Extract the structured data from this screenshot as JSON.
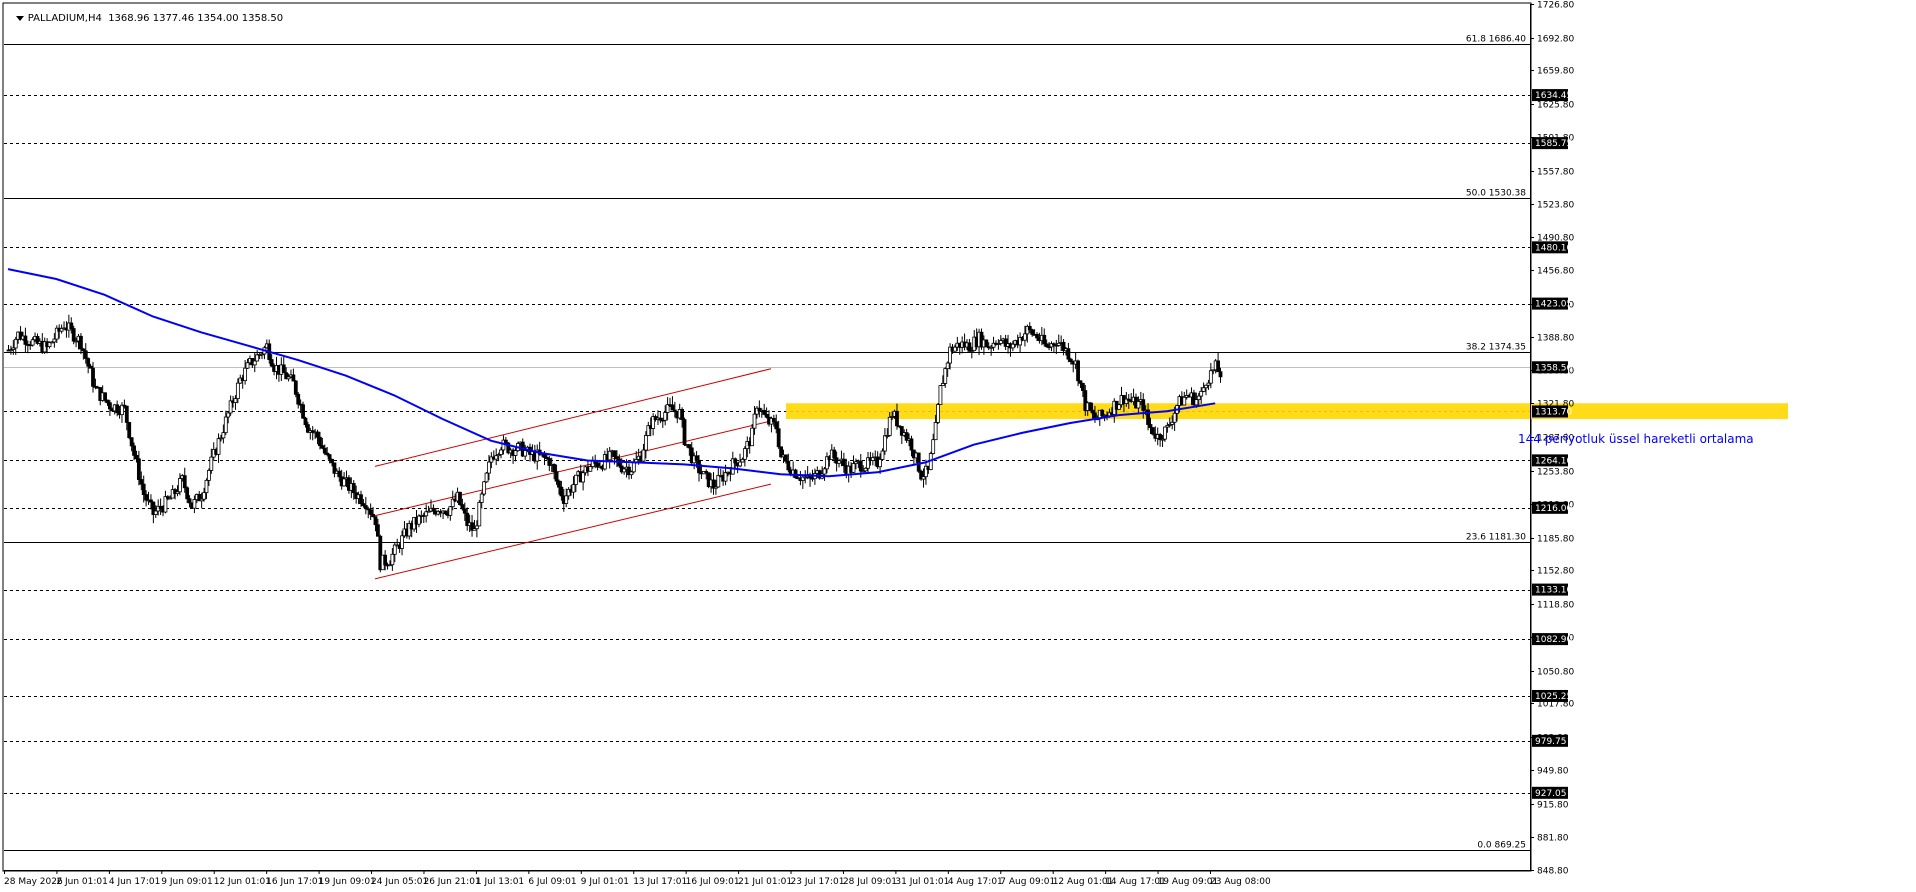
{
  "header": {
    "symbol_tf": "PALLADIUM,H4",
    "ohlc": "1368.96 1377.46 1354.00 1358.50"
  },
  "colors": {
    "background": "#ffffff",
    "grid": "#000000",
    "candle_bull": "#ffffff",
    "candle_bear": "#000000",
    "ema": "#0000ff",
    "channel": "#cc0000",
    "zone": "#ffd700",
    "annotation_text": "#0000ff",
    "price_tag_bg": "#000000",
    "price_tag_text": "#ffffff"
  },
  "annotation": "144 periyotluk üssel hareketli ortalama",
  "chart_data": {
    "type": "candlestick",
    "title": "PALLADIUM,H4",
    "ylim": [
      848.8,
      1726.8
    ],
    "y_ticks": [
      "1726.80",
      "1692.80",
      "1659.80",
      "1625.80",
      "1591.80",
      "1557.80",
      "1523.80",
      "1490.80",
      "1456.80",
      "1422.80",
      "1388.80",
      "1355.80",
      "1321.80",
      "1287.80",
      "1253.80",
      "1219.80",
      "1185.80",
      "1152.80",
      "1118.80",
      "1084.80",
      "1050.80",
      "1017.80",
      "983.80",
      "949.80",
      "915.80",
      "881.80",
      "848.80"
    ],
    "x_tick_labels": [
      "28 May 2026",
      "2 Jun 01:01",
      "4 Jun 17:01",
      "9 Jun 09:01",
      "12 Jun 01:01",
      "16 Jun 17:01",
      "19 Jun 09:01",
      "24 Jun 05:01",
      "26 Jun 21:01",
      "1 Jul 13:01",
      "6 Jul 09:01",
      "9 Jul 01:01",
      "13 Jul 17:01",
      "16 Jul 09:01",
      "21 Jul 01:01",
      "23 Jul 17:01",
      "28 Jul 09:01",
      "31 Jul 01:01",
      "4 Aug 17:01",
      "7 Aug 09:01",
      "12 Aug 01:01",
      "14 Aug 17:01",
      "19 Aug 09:01",
      "23 Aug 08:00"
    ],
    "horizontal_levels": [
      {
        "price": 1634.45,
        "label": "1634.45",
        "style": "dashed",
        "tag": true
      },
      {
        "price": 1585.75,
        "label": "1585.75",
        "style": "dashed",
        "tag": true
      },
      {
        "price": 1480.1,
        "label": "1480.10",
        "style": "dashed",
        "tag": true
      },
      {
        "price": 1423.05,
        "label": "1423.05",
        "style": "dashed",
        "tag": true
      },
      {
        "price": 1313.7,
        "label": "1313.70",
        "style": "dashed",
        "tag": true
      },
      {
        "price": 1264.1,
        "label": "1264.10",
        "style": "dashed",
        "tag": true
      },
      {
        "price": 1216.0,
        "label": "1216.00",
        "style": "dashed",
        "tag": true
      },
      {
        "price": 1133.1,
        "label": "1133.10",
        "style": "dashed",
        "tag": true
      },
      {
        "price": 1082.9,
        "label": "1082.90",
        "style": "dashed",
        "tag": true
      },
      {
        "price": 1025.25,
        "label": "1025.25",
        "style": "dashed",
        "tag": true
      },
      {
        "price": 979.75,
        "label": "979.75",
        "style": "dashed",
        "tag": true
      },
      {
        "price": 927.05,
        "label": "927.05",
        "style": "dashed",
        "tag": true
      }
    ],
    "fibo_levels": [
      {
        "price": 1686.4,
        "label": "61.8 1686.40"
      },
      {
        "price": 1530.38,
        "label": "50.0 1530.38"
      },
      {
        "price": 1374.35,
        "label": "38.2 1374.35"
      },
      {
        "price": 1181.3,
        "label": "23.6 1181.30"
      },
      {
        "price": 869.25,
        "label": "0.0 869.25"
      }
    ],
    "current_price": {
      "price": 1358.5,
      "label": "1358.50"
    },
    "zone": {
      "from_bar": 256,
      "to_bar": 585,
      "low": 1306,
      "high": 1322
    },
    "channel_lines": [
      {
        "bar1": 152,
        "price1": 1258,
        "bar2": 316,
        "price2": 1357
      },
      {
        "bar1": 152,
        "price1": 1208,
        "bar2": 316,
        "price2": 1304
      },
      {
        "bar1": 152,
        "price1": 1144,
        "bar2": 316,
        "price2": 1240
      }
    ],
    "close_path": [
      [
        0,
        1376
      ],
      [
        4,
        1392
      ],
      [
        10,
        1384
      ],
      [
        16,
        1378
      ],
      [
        23,
        1402
      ],
      [
        30,
        1384
      ],
      [
        36,
        1336
      ],
      [
        42,
        1320
      ],
      [
        48,
        1316
      ],
      [
        52,
        1270
      ],
      [
        56,
        1230
      ],
      [
        60,
        1210
      ],
      [
        64,
        1218
      ],
      [
        68,
        1228
      ],
      [
        72,
        1244
      ],
      [
        76,
        1218
      ],
      [
        80,
        1230
      ],
      [
        84,
        1262
      ],
      [
        88,
        1290
      ],
      [
        92,
        1318
      ],
      [
        96,
        1346
      ],
      [
        100,
        1362
      ],
      [
        104,
        1372
      ],
      [
        107,
        1380
      ],
      [
        110,
        1360
      ],
      [
        114,
        1352
      ],
      [
        118,
        1342
      ],
      [
        121,
        1320
      ],
      [
        124,
        1298
      ],
      [
        128,
        1288
      ],
      [
        132,
        1266
      ],
      [
        136,
        1250
      ],
      [
        140,
        1240
      ],
      [
        144,
        1230
      ],
      [
        148,
        1222
      ],
      [
        152,
        1204
      ],
      [
        154,
        1160
      ],
      [
        158,
        1164
      ],
      [
        162,
        1180
      ],
      [
        166,
        1196
      ],
      [
        170,
        1204
      ],
      [
        174,
        1210
      ],
      [
        178,
        1216
      ],
      [
        182,
        1214
      ],
      [
        186,
        1226
      ],
      [
        190,
        1200
      ],
      [
        193,
        1192
      ],
      [
        196,
        1226
      ],
      [
        200,
        1268
      ],
      [
        204,
        1280
      ],
      [
        208,
        1276
      ],
      [
        212,
        1276
      ],
      [
        216,
        1270
      ],
      [
        220,
        1268
      ],
      [
        224,
        1264
      ],
      [
        228,
        1236
      ],
      [
        230,
        1226
      ],
      [
        234,
        1240
      ],
      [
        238,
        1252
      ],
      [
        242,
        1260
      ],
      [
        246,
        1262
      ],
      [
        250,
        1268
      ],
      [
        254,
        1258
      ],
      [
        258,
        1256
      ],
      [
        262,
        1270
      ],
      [
        266,
        1302
      ],
      [
        270,
        1310
      ],
      [
        274,
        1316
      ],
      [
        278,
        1312
      ],
      [
        280,
        1286
      ],
      [
        284,
        1262
      ],
      [
        288,
        1248
      ],
      [
        292,
        1238
      ],
      [
        296,
        1248
      ],
      [
        300,
        1260
      ],
      [
        304,
        1268
      ],
      [
        308,
        1290
      ],
      [
        310,
        1322
      ],
      [
        314,
        1304
      ],
      [
        318,
        1298
      ],
      [
        320,
        1268
      ],
      [
        324,
        1256
      ],
      [
        328,
        1248
      ],
      [
        332,
        1244
      ],
      [
        336,
        1252
      ],
      [
        340,
        1270
      ],
      [
        344,
        1264
      ],
      [
        348,
        1254
      ],
      [
        352,
        1260
      ],
      [
        356,
        1260
      ],
      [
        360,
        1262
      ],
      [
        364,
        1296
      ],
      [
        366,
        1312
      ],
      [
        370,
        1296
      ],
      [
        374,
        1280
      ],
      [
        378,
        1250
      ],
      [
        381,
        1252
      ],
      [
        384,
        1296
      ],
      [
        386,
        1336
      ],
      [
        390,
        1376
      ],
      [
        394,
        1382
      ],
      [
        398,
        1380
      ],
      [
        402,
        1388
      ],
      [
        406,
        1380
      ],
      [
        410,
        1388
      ],
      [
        414,
        1378
      ],
      [
        418,
        1386
      ],
      [
        422,
        1396
      ],
      [
        426,
        1390
      ],
      [
        430,
        1378
      ],
      [
        434,
        1386
      ],
      [
        438,
        1376
      ],
      [
        442,
        1362
      ],
      [
        446,
        1320
      ],
      [
        450,
        1306
      ],
      [
        454,
        1310
      ],
      [
        458,
        1320
      ],
      [
        462,
        1328
      ],
      [
        466,
        1322
      ],
      [
        470,
        1320
      ],
      [
        472,
        1300
      ],
      [
        476,
        1288
      ],
      [
        480,
        1296
      ],
      [
        484,
        1320
      ],
      [
        488,
        1330
      ],
      [
        492,
        1326
      ],
      [
        494,
        1330
      ],
      [
        496,
        1346
      ],
      [
        500,
        1358
      ],
      [
        502,
        1352
      ]
    ],
    "ema_path": [
      [
        0,
        1458
      ],
      [
        20,
        1448
      ],
      [
        40,
        1432
      ],
      [
        60,
        1410
      ],
      [
        80,
        1394
      ],
      [
        100,
        1380
      ],
      [
        120,
        1366
      ],
      [
        140,
        1350
      ],
      [
        160,
        1330
      ],
      [
        180,
        1306
      ],
      [
        200,
        1284
      ],
      [
        220,
        1272
      ],
      [
        240,
        1264
      ],
      [
        260,
        1262
      ],
      [
        280,
        1260
      ],
      [
        300,
        1256
      ],
      [
        320,
        1250
      ],
      [
        340,
        1248
      ],
      [
        360,
        1252
      ],
      [
        380,
        1262
      ],
      [
        400,
        1280
      ],
      [
        420,
        1292
      ],
      [
        440,
        1302
      ],
      [
        460,
        1310
      ],
      [
        480,
        1314
      ],
      [
        500,
        1322
      ]
    ]
  }
}
